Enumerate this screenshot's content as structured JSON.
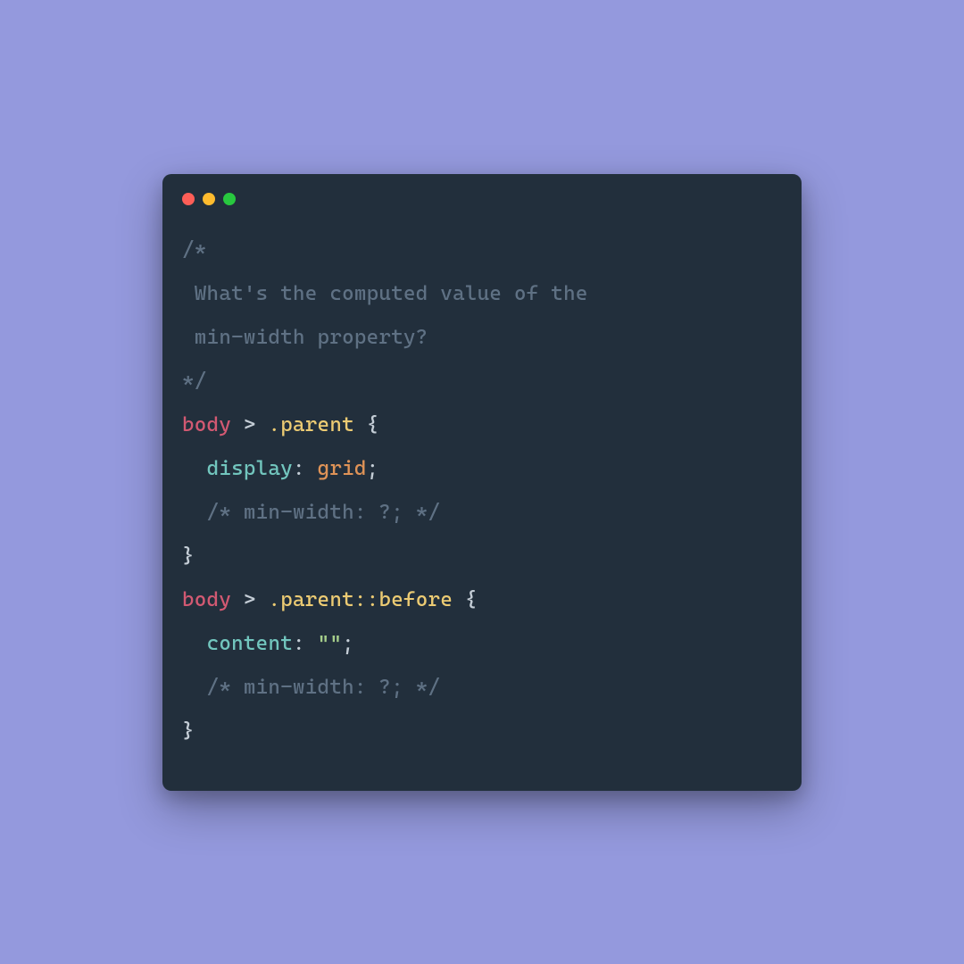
{
  "code": {
    "comment_open": "/*",
    "comment_line1": " What's the computed value of the",
    "comment_line2": " min-width property?",
    "comment_close": "*/",
    "sel1_tag": "body",
    "sel1_combinator": " > ",
    "sel1_class": ".parent",
    "brace_open": " {",
    "indent": "  ",
    "prop_display": "display",
    "colon_sp": ": ",
    "val_grid": "grid",
    "semi": ";",
    "inline_comment": "  /* min-width: ?; */",
    "brace_close": "}",
    "sel2_tag": "body",
    "sel2_combinator": " > ",
    "sel2_class": ".parent",
    "sel2_pseudo": "::before",
    "prop_content": "content",
    "val_empty": "\"\""
  }
}
